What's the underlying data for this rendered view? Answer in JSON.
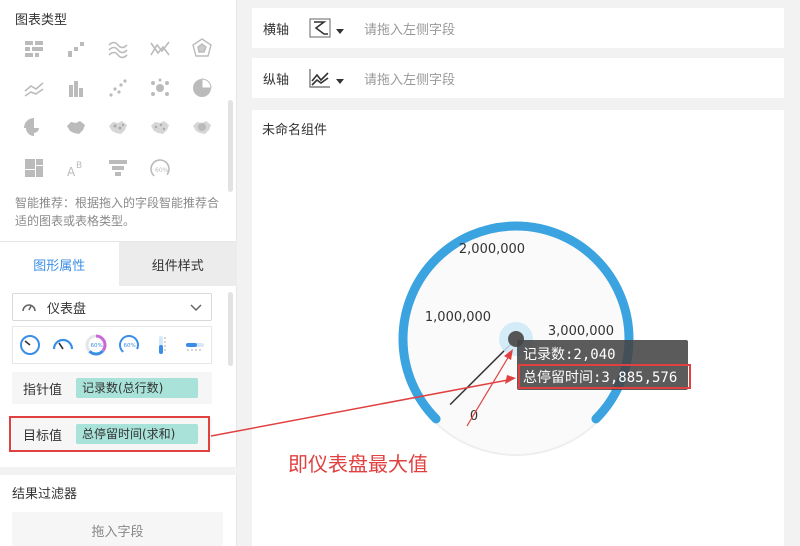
{
  "left_panel": {
    "section_title": "图表类型",
    "chart_types": [
      {
        "name": "table-chart-icon"
      },
      {
        "name": "grouped-bar-chart-icon"
      },
      {
        "name": "wave-chart-icon"
      },
      {
        "name": "radar-line-chart-icon"
      },
      {
        "name": "radar-chart-icon"
      },
      {
        "name": "line-chart-icon"
      },
      {
        "name": "bar-chart-icon"
      },
      {
        "name": "scatter-chart-icon"
      },
      {
        "name": "bubble-chart-icon"
      },
      {
        "name": "pie-chart-icon"
      },
      {
        "name": "rose-chart-icon"
      },
      {
        "name": "map-chart-icon"
      },
      {
        "name": "dot-map-icon"
      },
      {
        "name": "point-map-icon"
      },
      {
        "name": "heat-map-icon"
      },
      {
        "name": "treemap-chart-icon"
      },
      {
        "name": "word-cloud-icon"
      },
      {
        "name": "funnel-chart-icon"
      },
      {
        "name": "gauge-chart-icon"
      }
    ],
    "recommend_text": "智能推荐：根据拖入的字段智能推荐合适的图表或表格类型。",
    "tabs": {
      "graph_props": "图形属性",
      "component_style": "组件样式"
    },
    "gauge_select": {
      "value": "仪表盘"
    },
    "pointer_field": {
      "label": "指针值",
      "value": "记录数(总行数)"
    },
    "target_field": {
      "label": "目标值",
      "value": "总停留时间(求和)"
    },
    "filter": {
      "title": "结果过滤器",
      "placeholder": "拖入字段"
    }
  },
  "axes": {
    "x": {
      "label": "横轴",
      "placeholder": "请拖入左侧字段"
    },
    "y": {
      "label": "纵轴",
      "placeholder": "请拖入左侧字段"
    }
  },
  "component": {
    "title": "未命名组件"
  },
  "gauge": {
    "min": 0,
    "max": 3885576,
    "value": 2040,
    "ticks": [
      "0",
      "1,000,000",
      "2,000,000",
      "3,000,000"
    ],
    "arc_color": "#3aa3e0",
    "tooltip": {
      "line1": "记录数:2,040",
      "line2": "总停留时间:3,885,576"
    }
  },
  "annotation": {
    "text": "即仪表盘最大值",
    "color": "#e04040"
  }
}
